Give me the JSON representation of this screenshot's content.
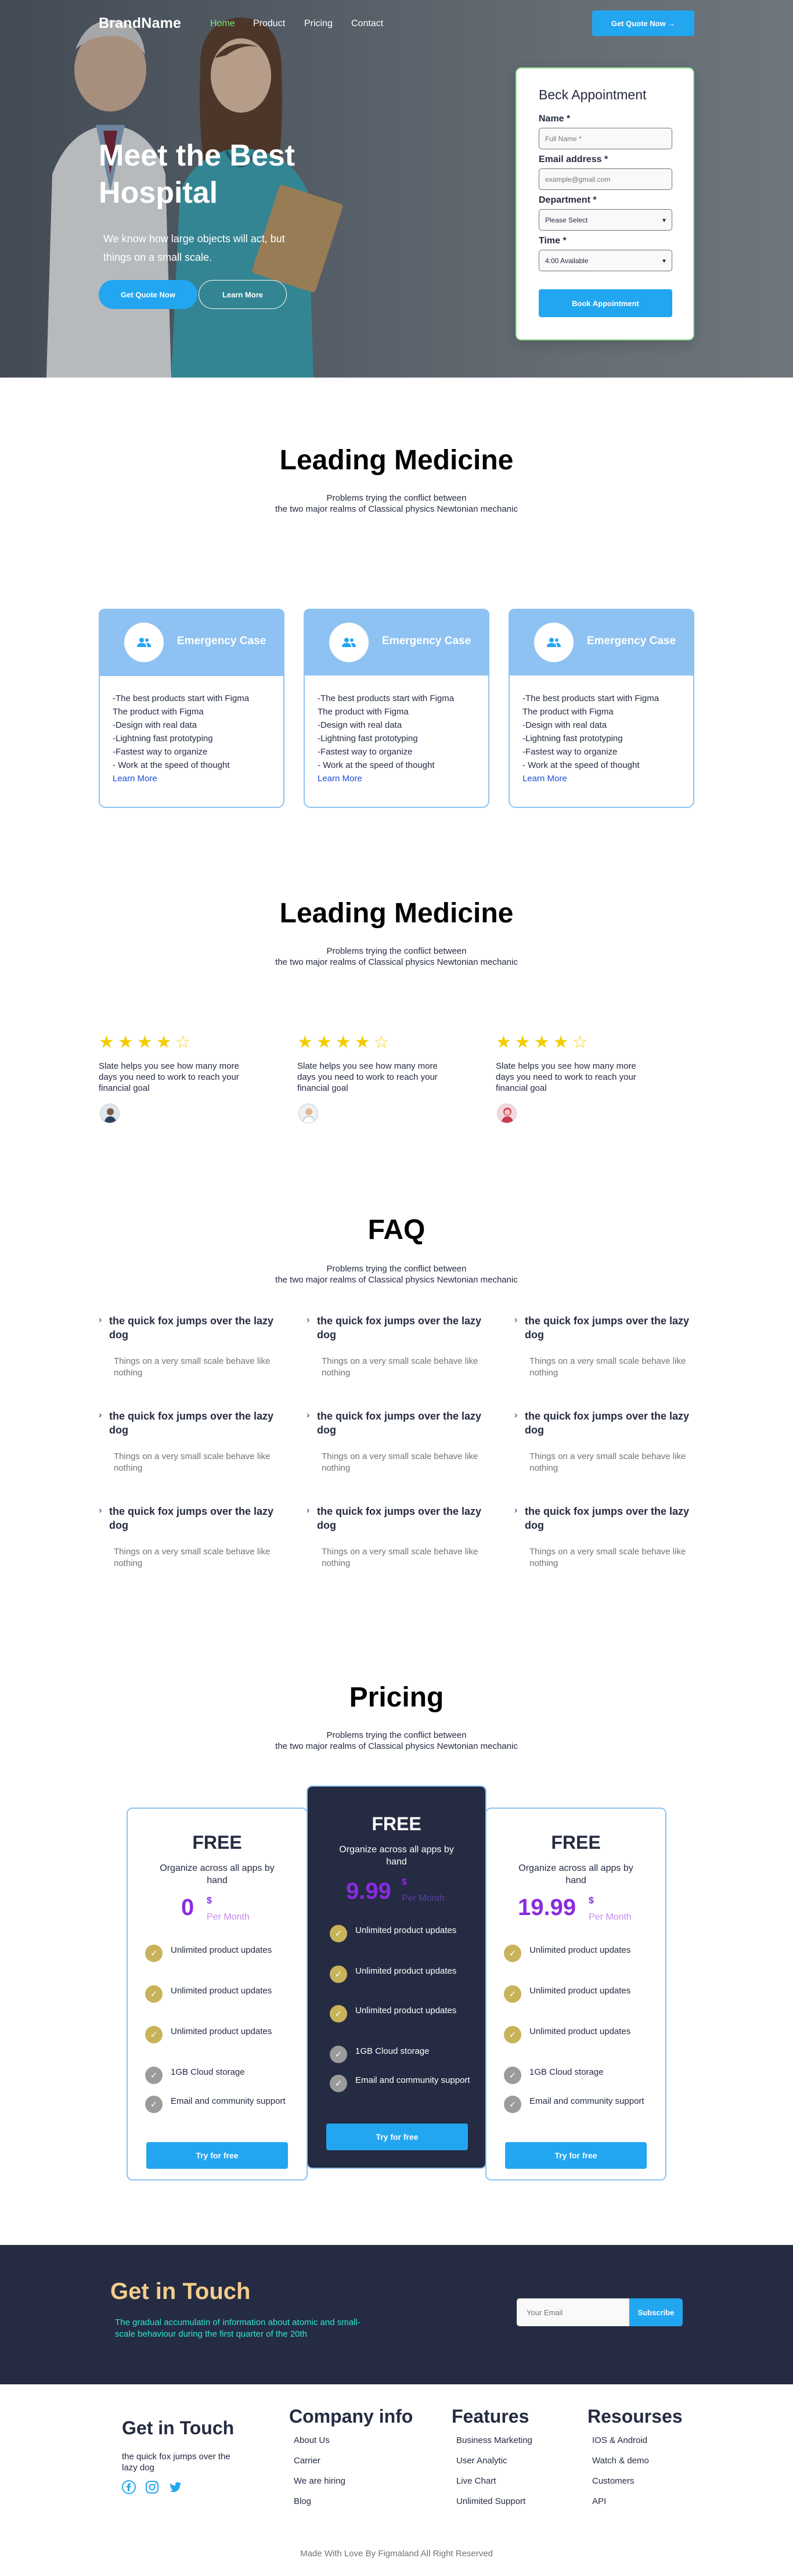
{
  "header": {
    "brand": "BrandName",
    "nav": [
      {
        "label": "Home",
        "active": true
      },
      {
        "label": "Product",
        "active": false
      },
      {
        "label": "Pricing",
        "active": false
      },
      {
        "label": "Contact",
        "active": false
      }
    ],
    "cta_label": "Get Quote Now →"
  },
  "hero": {
    "title": "Meet the Best Hospital",
    "subtitle": "We know how large objects will act, but things on a small scale.",
    "primary_button": "Get Quote Now",
    "secondary_button": "Learn More"
  },
  "appointment": {
    "title": "Beck Appointment",
    "name_label": "Name *",
    "name_placeholder": "Full Name *",
    "email_label": "Email address *",
    "email_placeholder": "example@gmail.com",
    "department_label": "Department *",
    "department_value": "Please Select",
    "time_label": "Time *",
    "time_value": "4:00 Available",
    "submit_label": "Book Appointment"
  },
  "services": {
    "title": "Leading Medicine",
    "subtitle_line1": "Problems trying the conflict between",
    "subtitle_line2": "the two major realms of Classical physics Newtonian mechanic",
    "cards": [
      {
        "title": "Emergency Case",
        "lines": [
          "-The best products start with Figma",
          "The product with Figma",
          "-Design with real data",
          "-Lightning fast prototyping",
          "-Fastest way to organize",
          "- Work at the speed of thought"
        ],
        "link": "Learn More"
      },
      {
        "title": "Emergency Case",
        "lines": [
          "-The best products start with Figma",
          "The product with Figma",
          "-Design with real data",
          "-Lightning fast prototyping",
          "-Fastest way to organize",
          "- Work at the speed of thought"
        ],
        "link": "Learn More"
      },
      {
        "title": "Emergency Case",
        "lines": [
          "-The best products start with Figma",
          "The product with Figma",
          "-Design with real data",
          "-Lightning fast prototyping",
          "-Fastest way to organize",
          "- Work at the speed of thought"
        ],
        "link": "Learn More"
      }
    ]
  },
  "testimonials": {
    "title": "Leading Medicine",
    "subtitle_line1": "Problems trying the conflict between",
    "subtitle_line2": "the two major realms of Classical physics Newtonian mechanic",
    "items": [
      {
        "rating": 4,
        "max": 5,
        "text": "Slate helps you see how many more days you need to work to reach your financial goal"
      },
      {
        "rating": 4,
        "max": 5,
        "text": "Slate helps you see how many more days you need to work to reach your financial goal"
      },
      {
        "rating": 4,
        "max": 5,
        "text": "Slate helps you see how many more days you need to work to reach your financial goal"
      }
    ]
  },
  "faq": {
    "title": "FAQ",
    "subtitle_line1": "Problems trying the conflict between",
    "subtitle_line2": "the two major realms of Classical physics Newtonian mechanic",
    "items": [
      {
        "q": "the quick fox jumps over the lazy dog",
        "a": "Things on a very small scale behave like nothing"
      },
      {
        "q": "the quick fox jumps over the lazy dog",
        "a": "Things on a very small scale behave like nothing"
      },
      {
        "q": "the quick fox jumps over the lazy dog",
        "a": "Things on a very small scale behave like nothing"
      },
      {
        "q": "the quick fox jumps over the lazy dog",
        "a": "Things on a very small scale behave like nothing"
      },
      {
        "q": "the quick fox jumps over the lazy dog",
        "a": "Things on a very small scale behave like nothing"
      },
      {
        "q": "the quick fox jumps over the lazy dog",
        "a": "Things on a very small scale behave like nothing"
      },
      {
        "q": "the quick fox jumps over the lazy dog",
        "a": "Things on a very small scale behave like nothing"
      },
      {
        "q": "the quick fox jumps over the lazy dog",
        "a": "Things on a very small scale behave like nothing"
      },
      {
        "q": "the quick fox jumps over the lazy dog",
        "a": "Things on a very small scale behave like nothing"
      }
    ]
  },
  "pricing": {
    "title": "Pricing",
    "subtitle_line1": "Problems trying the conflict between",
    "subtitle_line2": "the two major realms of Classical physics Newtonian mechanic",
    "plans": [
      {
        "name": "FREE",
        "desc": "Organize across all apps by hand",
        "price": "0",
        "currency": "$",
        "per": "Per Month",
        "features": [
          "Unlimited product updates",
          "Unlimited product updates",
          "Unlimited product updates",
          "1GB Cloud storage",
          "Email and community support"
        ],
        "button": "Try for free"
      },
      {
        "name": "FREE",
        "desc": "Organize across all apps by hand",
        "price": "9.99",
        "currency": "$",
        "per": "Per Month",
        "features": [
          "Unlimited product updates",
          "Unlimited product updates",
          "Unlimited product updates",
          "1GB Cloud storage",
          "Email and community support"
        ],
        "button": "Try for free"
      },
      {
        "name": "FREE",
        "desc": "Organize across all apps by hand",
        "price": "19.99",
        "currency": "$",
        "per": "Per Month",
        "features": [
          "Unlimited product updates",
          "Unlimited product updates",
          "Unlimited product updates",
          "1GB Cloud storage",
          "Email and community support"
        ],
        "button": "Try for free"
      }
    ]
  },
  "newsletter": {
    "title": "Get in Touch",
    "text": "The gradual accumulatin of information about atomic and small-scale behaviour during the first quarter of the 20th",
    "email_placeholder": "Your Email",
    "button": "Subscribe"
  },
  "footer": {
    "contact_title": "Get in Touch",
    "contact_text": "the quick fox jumps over the lazy dog",
    "social": [
      "facebook-icon",
      "instagram-icon",
      "twitter-icon"
    ],
    "columns": [
      {
        "title": "Company info",
        "links": [
          "About Us",
          "Carrier",
          "We are hiring",
          "Blog"
        ]
      },
      {
        "title": "Features",
        "links": [
          "Business Marketing",
          "User Analytic",
          "Live Chart",
          "Unlimited Support"
        ]
      },
      {
        "title": "Resourses",
        "links": [
          "IOS & Android",
          "Watch & demo",
          "Customers",
          "API"
        ]
      }
    ],
    "bottom_text": "Made With Love By Figmaland All Right Reserved"
  },
  "colors": {
    "primary": "#23a6f0",
    "dark": "#252b42",
    "nav_active": "#7ae67a",
    "card_blue": "#8ec2f2",
    "star": "#f3cd03",
    "price_purple": "#8a2be2",
    "check_gold": "#c8b35a",
    "check_gray": "#9b9b9b",
    "newsletter_title": "#f3cd8b",
    "newsletter_text": "#2ee6d0"
  }
}
